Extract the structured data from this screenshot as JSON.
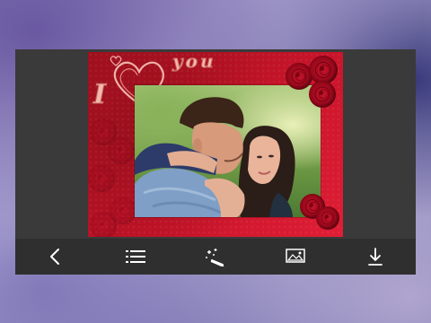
{
  "frame": {
    "overlay_text_i": "I",
    "overlay_text_you": "you"
  },
  "toolbar": {
    "items": [
      {
        "icon": "back-arrow-icon"
      },
      {
        "icon": "list-icon"
      },
      {
        "icon": "magic-wand-icon"
      },
      {
        "icon": "image-icon"
      },
      {
        "icon": "download-icon"
      }
    ]
  },
  "colors": {
    "frame_red": "#c8142a",
    "toolbar_bg": "#2f2f2f",
    "canvas_bg": "#3a3a3a",
    "icon_color": "#ffffff"
  }
}
